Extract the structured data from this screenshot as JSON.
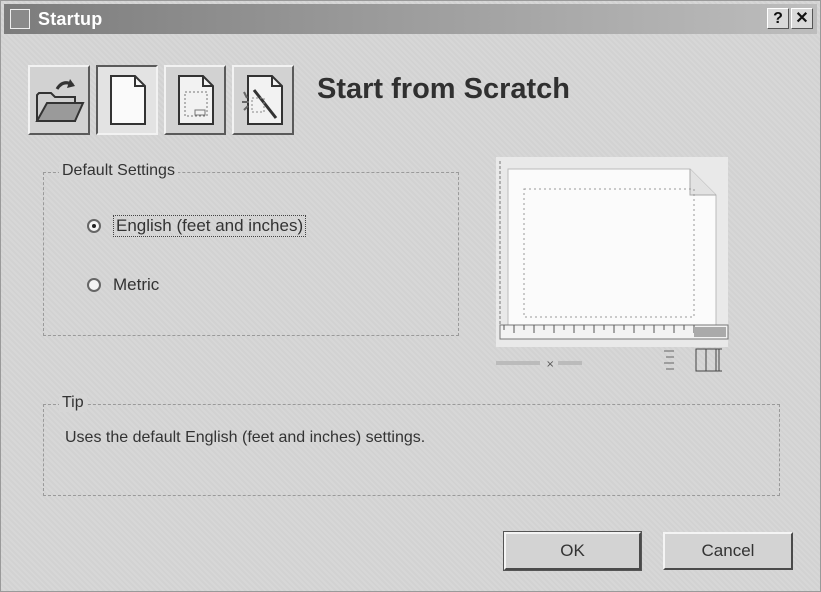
{
  "window": {
    "title": "Startup",
    "help_label": "?",
    "close_label": "✕"
  },
  "toolbar": {
    "buttons": [
      {
        "name": "open-drawing",
        "icon": "open-folder-icon",
        "active": false
      },
      {
        "name": "start-from-scratch",
        "icon": "blank-page-icon",
        "active": true
      },
      {
        "name": "use-template",
        "icon": "template-page-icon",
        "active": false
      },
      {
        "name": "use-wizard",
        "icon": "wizard-page-icon",
        "active": false
      }
    ]
  },
  "wizard_title": "Start from Scratch",
  "default_settings": {
    "legend": "Default Settings",
    "options": [
      {
        "label": "English (feet and inches)",
        "selected": true
      },
      {
        "label": "Metric",
        "selected": false
      }
    ]
  },
  "tip": {
    "legend": "Tip",
    "text": "Uses the default English (feet and inches) settings."
  },
  "buttons": {
    "ok_label": "OK",
    "cancel_label": "Cancel"
  }
}
